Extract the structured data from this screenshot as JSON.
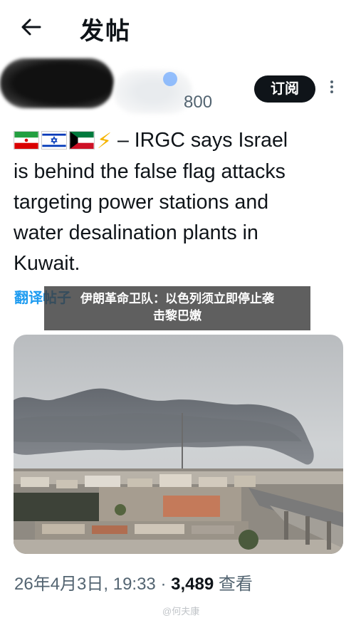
{
  "header": {
    "title": "发帖",
    "back_icon": "arrow-left-icon"
  },
  "author": {
    "handle": "800",
    "subscribe_label": "订阅"
  },
  "tweet": {
    "text_prefix": " – IRGC says Israel",
    "text_lines": [
      "is behind the false flag attacks",
      "targeting power stations and",
      "water desalination plants in",
      "Kuwait."
    ],
    "flags": [
      "iran-flag",
      "israel-flag",
      "kuwait-flag"
    ],
    "emoji": "⚡",
    "translate_label": "翻译帖子"
  },
  "overlay": {
    "line1": "伊朗革命卫队：以色列须立即停止袭",
    "line2": "击黎巴嫩"
  },
  "meta": {
    "datetime": "26年4月3日, 19:33",
    "separator": " · ",
    "views_count": "3,489",
    "views_label": " 查看"
  },
  "watermark": "@何夫康"
}
